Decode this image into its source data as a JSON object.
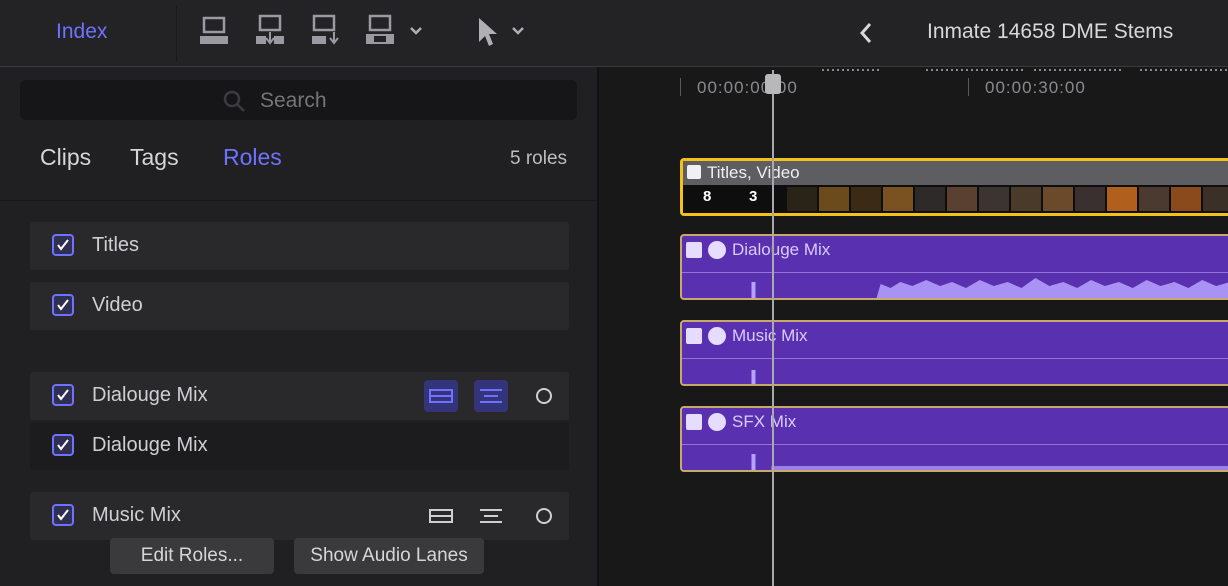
{
  "toolbar": {
    "index_label": "Index",
    "project_title": "Inmate 14658 DME Stems"
  },
  "index_panel": {
    "search_placeholder": "Search",
    "tabs": [
      {
        "label": "Clips",
        "selected": false
      },
      {
        "label": "Tags",
        "selected": false
      },
      {
        "label": "Roles",
        "selected": true
      }
    ],
    "roles_count": "5 roles",
    "roles": [
      {
        "label": "Titles",
        "checked": true
      },
      {
        "label": "Video",
        "checked": true
      },
      {
        "label": "Dialouge Mix",
        "checked": true,
        "lanes_enabled": true
      },
      {
        "label": "Dialouge Mix",
        "checked": true,
        "subrole": true
      },
      {
        "label": "Music Mix",
        "checked": true,
        "lanes_enabled": false
      }
    ],
    "edit_roles_label": "Edit Roles...",
    "show_audio_lanes_label": "Show Audio Lanes"
  },
  "timeline": {
    "timecodes": [
      "00:00:00:00",
      "00:00:30:00"
    ],
    "video_clip": {
      "title": "Titles, Video",
      "overlay_text": [
        "8",
        "3"
      ]
    },
    "audio_clips": [
      {
        "name": "Dialouge Mix"
      },
      {
        "name": "Music Mix"
      },
      {
        "name": "SFX Mix"
      }
    ]
  },
  "colors": {
    "accent": "#6f72ff",
    "selection_border": "#f2c21a",
    "audio_clip": "#5930b0"
  }
}
